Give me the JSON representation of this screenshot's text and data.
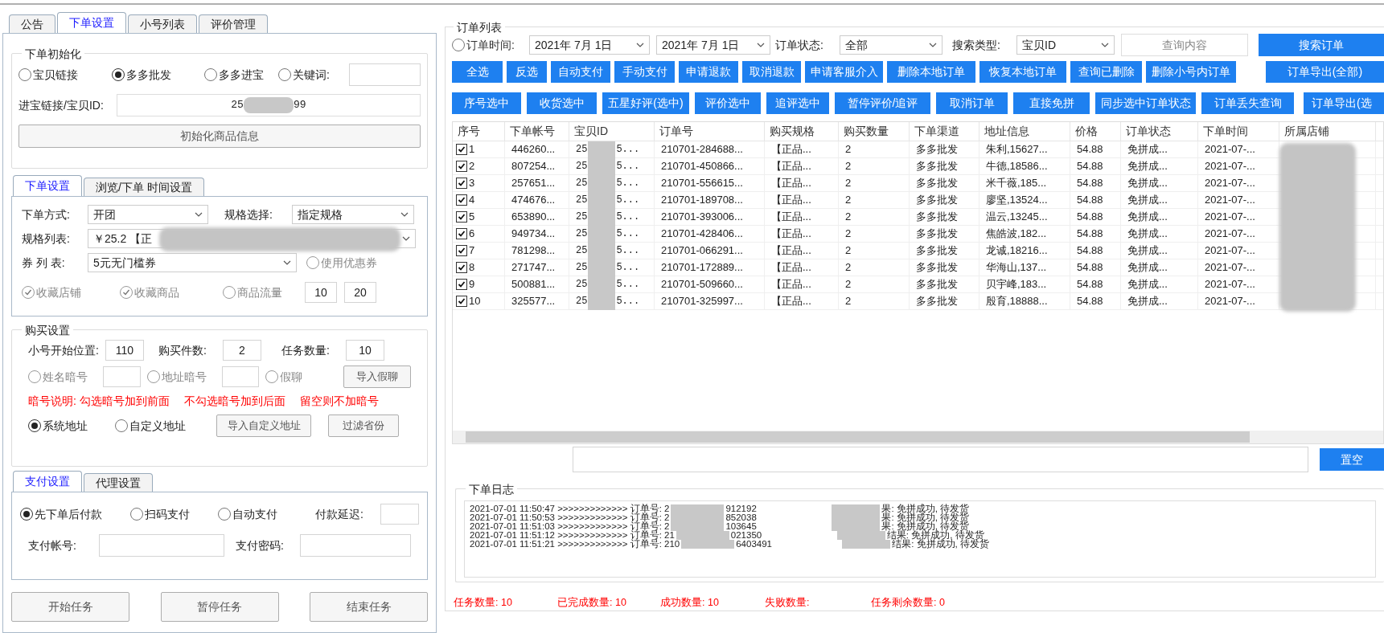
{
  "left_tabs": [
    {
      "label": "公告",
      "selected": false
    },
    {
      "label": "下单设置",
      "selected": true
    },
    {
      "label": "小号列表",
      "selected": false
    },
    {
      "label": "评价管理",
      "selected": false
    }
  ],
  "init_group": {
    "title": "下单初始化",
    "options": [
      {
        "label": "宝贝链接",
        "selected": false
      },
      {
        "label": "多多批发",
        "selected": true
      },
      {
        "label": "多多进宝",
        "selected": false
      },
      {
        "label": "关键词:",
        "selected": false
      }
    ],
    "id_label": "进宝链接/宝贝ID:",
    "id_value_start": "25",
    "id_value_end": "99",
    "init_button": "初始化商品信息"
  },
  "order_tabs": [
    {
      "label": "下单设置",
      "selected": true
    },
    {
      "label": "浏览/下单 时间设置",
      "selected": false
    }
  ],
  "order_settings": {
    "mode_label": "下单方式:",
    "mode": "开团",
    "spec_choice_label": "规格选择:",
    "spec_choice": "指定规格",
    "spec_list_label": "规格列表:",
    "spec_list_value": "￥25.2 【正",
    "coupon_label": "券 列 表:",
    "coupon": "5元无门槛券",
    "use_coupon": {
      "label": "使用优惠券",
      "checked": false,
      "disabled": true
    },
    "checks": [
      {
        "label": "收藏店铺",
        "checked": true,
        "disabled": true
      },
      {
        "label": "收藏商品",
        "checked": true,
        "disabled": true
      },
      {
        "label": "商品流量",
        "checked": false,
        "disabled": true
      }
    ],
    "traffic_min": "10",
    "traffic_max": "20"
  },
  "purchase": {
    "title": "购买设置",
    "start_label": "小号开始位置:",
    "start": "110",
    "qty_label": "购买件数:",
    "qty": "2",
    "tasks_label": "任务数量:",
    "tasks": "10",
    "codes": [
      {
        "label": "姓名暗号",
        "checked": false,
        "disabled": true,
        "kind": "field"
      },
      {
        "label": "地址暗号",
        "checked": false,
        "disabled": true,
        "kind": "field"
      },
      {
        "label": "假聊",
        "checked": false,
        "disabled": true,
        "kind": "plain"
      }
    ],
    "import_chat_button": "导入假聊",
    "note": "暗号说明: 勾选暗号加到前面　 不勾选暗号加到后面　 留空则不加暗号",
    "address_options": [
      {
        "label": "系统地址",
        "selected": true
      },
      {
        "label": "自定义地址",
        "selected": false
      }
    ],
    "address_buttons": [
      "导入自定义地址",
      "过滤省份"
    ]
  },
  "pay_tabs": [
    {
      "label": "支付设置",
      "selected": true
    },
    {
      "label": "代理设置",
      "selected": false
    }
  ],
  "pay": {
    "options": [
      {
        "label": "先下单后付款",
        "selected": true
      },
      {
        "label": "扫码支付",
        "selected": false
      },
      {
        "label": "自动支付",
        "selected": false
      }
    ],
    "delay_label": "付款延迟:",
    "account_label": "支付帐号:",
    "password_label": "支付密码:"
  },
  "task_buttons": [
    "开始任务",
    "暂停任务",
    "结束任务"
  ],
  "order_list": {
    "title": "订单列表",
    "time_filter": {
      "label": "订单时间:",
      "selected": false
    },
    "date_from": "2021年 7月 1日",
    "date_to": "2021年 7月 1日",
    "status_label": "订单状态:",
    "status": "全部",
    "search_type_label": "搜索类型:",
    "search_type": "宝贝ID",
    "query_placeholder": "查询内容",
    "search_button": "搜索订单"
  },
  "action_rows": [
    {
      "buttons": [
        "全选",
        "反选",
        "自动支付",
        "手动支付",
        "申请退款",
        "取消退款",
        "申请客服介入",
        "删除本地订单",
        "恢复本地订单",
        "查询已删除",
        "删除小号内订单"
      ],
      "export": "订单导出(全部)"
    },
    {
      "buttons": [
        "序号选中",
        "收货选中",
        "五星好评(选中)",
        "评价选中",
        "追评选中",
        "暂停评价/追评",
        "取消订单",
        "直接免拼",
        "同步选中订单状态",
        "订单丢失查询"
      ],
      "export": "订单导出(选"
    }
  ],
  "table": {
    "columns": [
      "序号",
      "下单帐号",
      "宝贝ID",
      "订单号",
      "购买规格",
      "购买数量",
      "下单渠道",
      "地址信息",
      "价格",
      "订单状态",
      "下单时间",
      "所属店铺"
    ],
    "rows": [
      {
        "checked": true,
        "index": "1",
        "account": "446260...",
        "item_id_start": "25",
        "item_id_end": "5...",
        "order_no": "210701-284688...",
        "spec": "【正品...",
        "qty": "2",
        "channel": "多多批发",
        "address": "朱利,15627...",
        "price": "54.88",
        "status": "免拼成...",
        "time": "2021-07-..."
      },
      {
        "checked": true,
        "index": "2",
        "account": "807254...",
        "item_id_start": "25",
        "item_id_end": "5...",
        "order_no": "210701-450866...",
        "spec": "【正品...",
        "qty": "2",
        "channel": "多多批发",
        "address": "牛德,18586...",
        "price": "54.88",
        "status": "免拼成...",
        "time": "2021-07-..."
      },
      {
        "checked": true,
        "index": "3",
        "account": "257651...",
        "item_id_start": "25",
        "item_id_end": "5...",
        "order_no": "210701-556615...",
        "spec": "【正品...",
        "qty": "2",
        "channel": "多多批发",
        "address": "米千薇,185...",
        "price": "54.88",
        "status": "免拼成...",
        "time": "2021-07-..."
      },
      {
        "checked": true,
        "index": "4",
        "account": "474676...",
        "item_id_start": "25",
        "item_id_end": "5...",
        "order_no": "210701-189708...",
        "spec": "【正品...",
        "qty": "2",
        "channel": "多多批发",
        "address": "廖坚,13524...",
        "price": "54.88",
        "status": "免拼成...",
        "time": "2021-07-..."
      },
      {
        "checked": true,
        "index": "5",
        "account": "653890...",
        "item_id_start": "25",
        "item_id_end": "5...",
        "order_no": "210701-393006...",
        "spec": "【正品...",
        "qty": "2",
        "channel": "多多批发",
        "address": "温云,13245...",
        "price": "54.88",
        "status": "免拼成...",
        "time": "2021-07-..."
      },
      {
        "checked": true,
        "index": "6",
        "account": "949734...",
        "item_id_start": "25",
        "item_id_end": "5...",
        "order_no": "210701-428406...",
        "spec": "【正品...",
        "qty": "2",
        "channel": "多多批发",
        "address": "焦皓波,182...",
        "price": "54.88",
        "status": "免拼成...",
        "time": "2021-07-..."
      },
      {
        "checked": true,
        "index": "7",
        "account": "781298...",
        "item_id_start": "25",
        "item_id_end": "5...",
        "order_no": "210701-066291...",
        "spec": "【正品...",
        "qty": "2",
        "channel": "多多批发",
        "address": "龙诚,18216...",
        "price": "54.88",
        "status": "免拼成...",
        "time": "2021-07-..."
      },
      {
        "checked": true,
        "index": "8",
        "account": "271747...",
        "item_id_start": "25",
        "item_id_end": "5...",
        "order_no": "210701-172889...",
        "spec": "【正品...",
        "qty": "2",
        "channel": "多多批发",
        "address": "华海山,137...",
        "price": "54.88",
        "status": "免拼成...",
        "time": "2021-07-..."
      },
      {
        "checked": true,
        "index": "9",
        "account": "500881...",
        "item_id_start": "25",
        "item_id_end": "5...",
        "order_no": "210701-509660...",
        "spec": "【正品...",
        "qty": "2",
        "channel": "多多批发",
        "address": "贝宇峰,183...",
        "price": "54.88",
        "status": "免拼成...",
        "time": "2021-07-..."
      },
      {
        "checked": true,
        "index": "10",
        "account": "325577...",
        "item_id_start": "25",
        "item_id_end": "5...",
        "order_no": "210701-325997...",
        "spec": "【正品...",
        "qty": "2",
        "channel": "多多批发",
        "address": "殷育,18888...",
        "price": "54.88",
        "status": "免拼成...",
        "time": "2021-07-..."
      }
    ]
  },
  "clear_button": "置空",
  "log": {
    "title": "下单日志",
    "lines": [
      {
        "prefix": "2021-07-01 11:50:47 >>>>>>>>>>>>> 订单号: 2",
        "middle": "912192",
        "result": "果: 免拼成功, 待发货"
      },
      {
        "prefix": "2021-07-01 11:50:53 >>>>>>>>>>>>> 订单号: 2",
        "middle": "852038",
        "result": "果: 免拼成功, 待发货"
      },
      {
        "prefix": "2021-07-01 11:51:03 >>>>>>>>>>>>> 订单号: 2",
        "middle": "103645",
        "result": "果: 免拼成功, 待发货"
      },
      {
        "prefix": "2021-07-01 11:51:12 >>>>>>>>>>>>> 订单号: 21",
        "middle": "021350",
        "result": "结果: 免拼成功, 待发货"
      },
      {
        "prefix": "2021-07-01 11:51:21 >>>>>>>>>>>>> 订单号: 210",
        "middle": "6403491",
        "result": "结果: 免拼成功, 待发货"
      }
    ]
  },
  "summary": [
    "任务数量: 10",
    "已完成数量: 10",
    "成功数量: 10",
    "失败数量:",
    "任务剩余数量: 0"
  ]
}
